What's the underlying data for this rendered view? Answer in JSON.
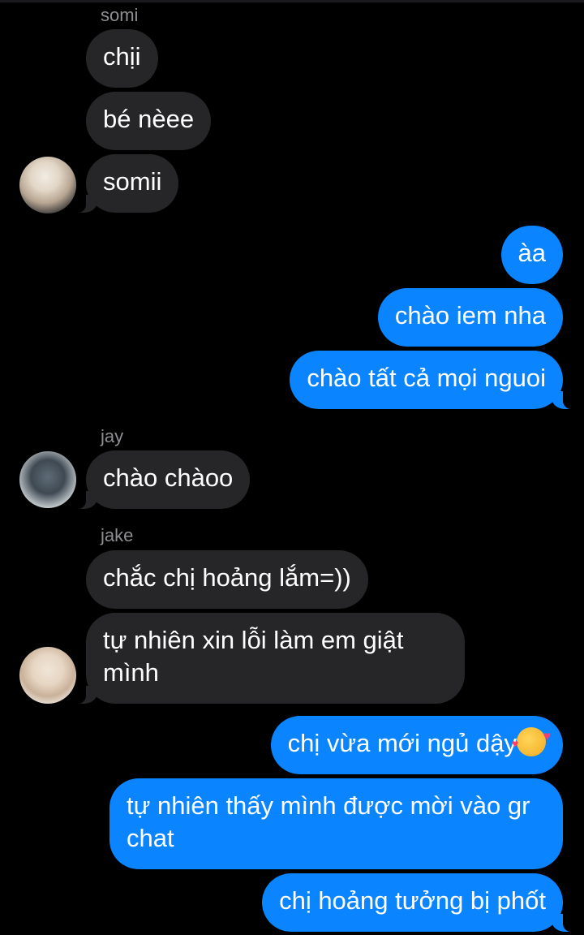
{
  "messages": {
    "somi_name": "somi",
    "somi_1": "chịi",
    "somi_2": "bé nèee",
    "somi_3": "somii",
    "me_1": "àa",
    "me_2": "chào iem nha",
    "me_3": "chào tất cả mọi nguoi",
    "jay_name": "jay",
    "jay_1": "chào chàoo",
    "jake_name": "jake",
    "jake_1": "chắc chị hoảng lắm=))",
    "jake_2": "tự nhiên xin lỗi làm em giật mình",
    "me_4": "chị vừa mới ngủ dậy",
    "me_4_emoji": "smiling-face-with-hearts",
    "me_5": "tự nhiên thấy mình được mời vào gr chat",
    "me_6": "chị hoảng tưởng bị phốt"
  },
  "colors": {
    "incoming_bubble": "#262628",
    "outgoing_bubble": "#0a84ff",
    "sender_name": "#8e8e93",
    "background": "#000000"
  }
}
